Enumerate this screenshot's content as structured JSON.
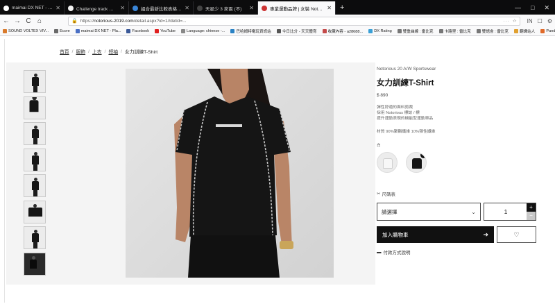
{
  "browser": {
    "tabs": [
      {
        "title": "maimai DX NET - Home -",
        "fav_color": "#ffffff",
        "active": false
      },
      {
        "title": "Challenge track 挑戰 | Mem",
        "fav_color": "#f2f2f2",
        "active": false
      },
      {
        "title": "組合最新比較表格 1.0 版本",
        "fav_color": "#3a86d8",
        "active": false
      },
      {
        "title": "天星少 3 來兩 (不)",
        "fav_color": "#444444",
        "active": false
      },
      {
        "title": "專業運動品牌 | 女裝 Notorious",
        "fav_color": "#cc3333",
        "active": true
      }
    ],
    "new_tab": "+",
    "window_controls": [
      "—",
      "□",
      "✕"
    ],
    "nav": {
      "back": "←",
      "forward": "→",
      "reload": "C",
      "home": "⌂"
    },
    "url": {
      "host": "notorious-2019.com",
      "prefix": "https://",
      "path": "/detail.aspx?id=1//detid=..."
    },
    "url_menu": "···",
    "toolbar_icons": [
      "IN",
      "☐",
      "⚙"
    ],
    "bookmarks": [
      {
        "label": "SOUND VOLTEX VIV...",
        "color": "#d97a2b"
      },
      {
        "label": "Ecore",
        "color": "#6a6a6a"
      },
      {
        "label": "maimai DX NET - Pla...",
        "color": "#4a6fc4"
      },
      {
        "label": "Facebook",
        "color": "#3b5998"
      },
      {
        "label": "YouTube",
        "color": "#e02020"
      },
      {
        "label": "Language: chinese -...",
        "color": "#888888"
      },
      {
        "label": "巴哈姆特電玩資訊站",
        "color": "#2a82c4"
      },
      {
        "label": "今日比分 - 天天體育",
        "color": "#555555"
      },
      {
        "label": "收藏內容 - a28688...",
        "color": "#c44a4a"
      },
      {
        "label": "DX Rating",
        "color": "#3aa0d6"
      },
      {
        "label": "雙重曲線 : 雷比克",
        "color": "#777777"
      },
      {
        "label": "卡路里 : 雷比克",
        "color": "#777777"
      },
      {
        "label": "雙語會 : 雷比克",
        "color": "#777777"
      },
      {
        "label": "翻譯站人",
        "color": "#e0a030"
      },
      {
        "label": "Pandora Shop",
        "color": "#e06a2a"
      }
    ]
  },
  "breadcrumb": {
    "items": [
      "首頁",
      "服飾",
      "上衣",
      "短袖"
    ],
    "current": "女力訓練T-Shirt",
    "separator": "/"
  },
  "product": {
    "season": "Notorious 20 A/W Sportswear",
    "title": "女力訓練T-Shirt",
    "price": "$ 890",
    "description": [
      "彈性舒適的面料剪裁",
      "採用 Notorious 標誌 / 標",
      "提升運動表現的機能型運動單品"
    ],
    "material": "材質 90%聚酯纖維 10%彈性纖維",
    "color_hint": "白"
  },
  "swatches": [
    {
      "name": "white",
      "shirt_color": "#f5f5f5",
      "selected": false
    },
    {
      "name": "black",
      "shirt_color": "#151515",
      "selected": true
    }
  ],
  "size_chart_label": "尺碼表",
  "size_select": {
    "value": "請選擇"
  },
  "quantity": {
    "value": "1",
    "plus": "+",
    "minus": "−"
  },
  "add_to_cart": {
    "label": "加入購物車",
    "arrow": "➔"
  },
  "wishlist_icon": "♡",
  "payment_label": "付款方式說明",
  "colors": {
    "chrome_dark": "#0c0c0d",
    "accent_black": "#111111"
  }
}
